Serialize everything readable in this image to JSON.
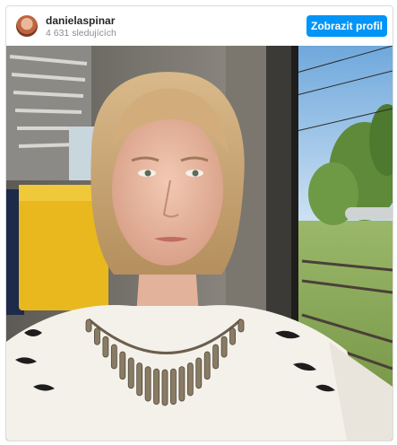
{
  "post": {
    "username": "danielaspinar",
    "followers": "4 631 sledujících",
    "view_profile_label": "Zobrazit profil"
  },
  "icons": {
    "avatar": "profile-photo-avatar"
  },
  "colors": {
    "button": "#0095f6",
    "border": "#dbdbdb"
  }
}
